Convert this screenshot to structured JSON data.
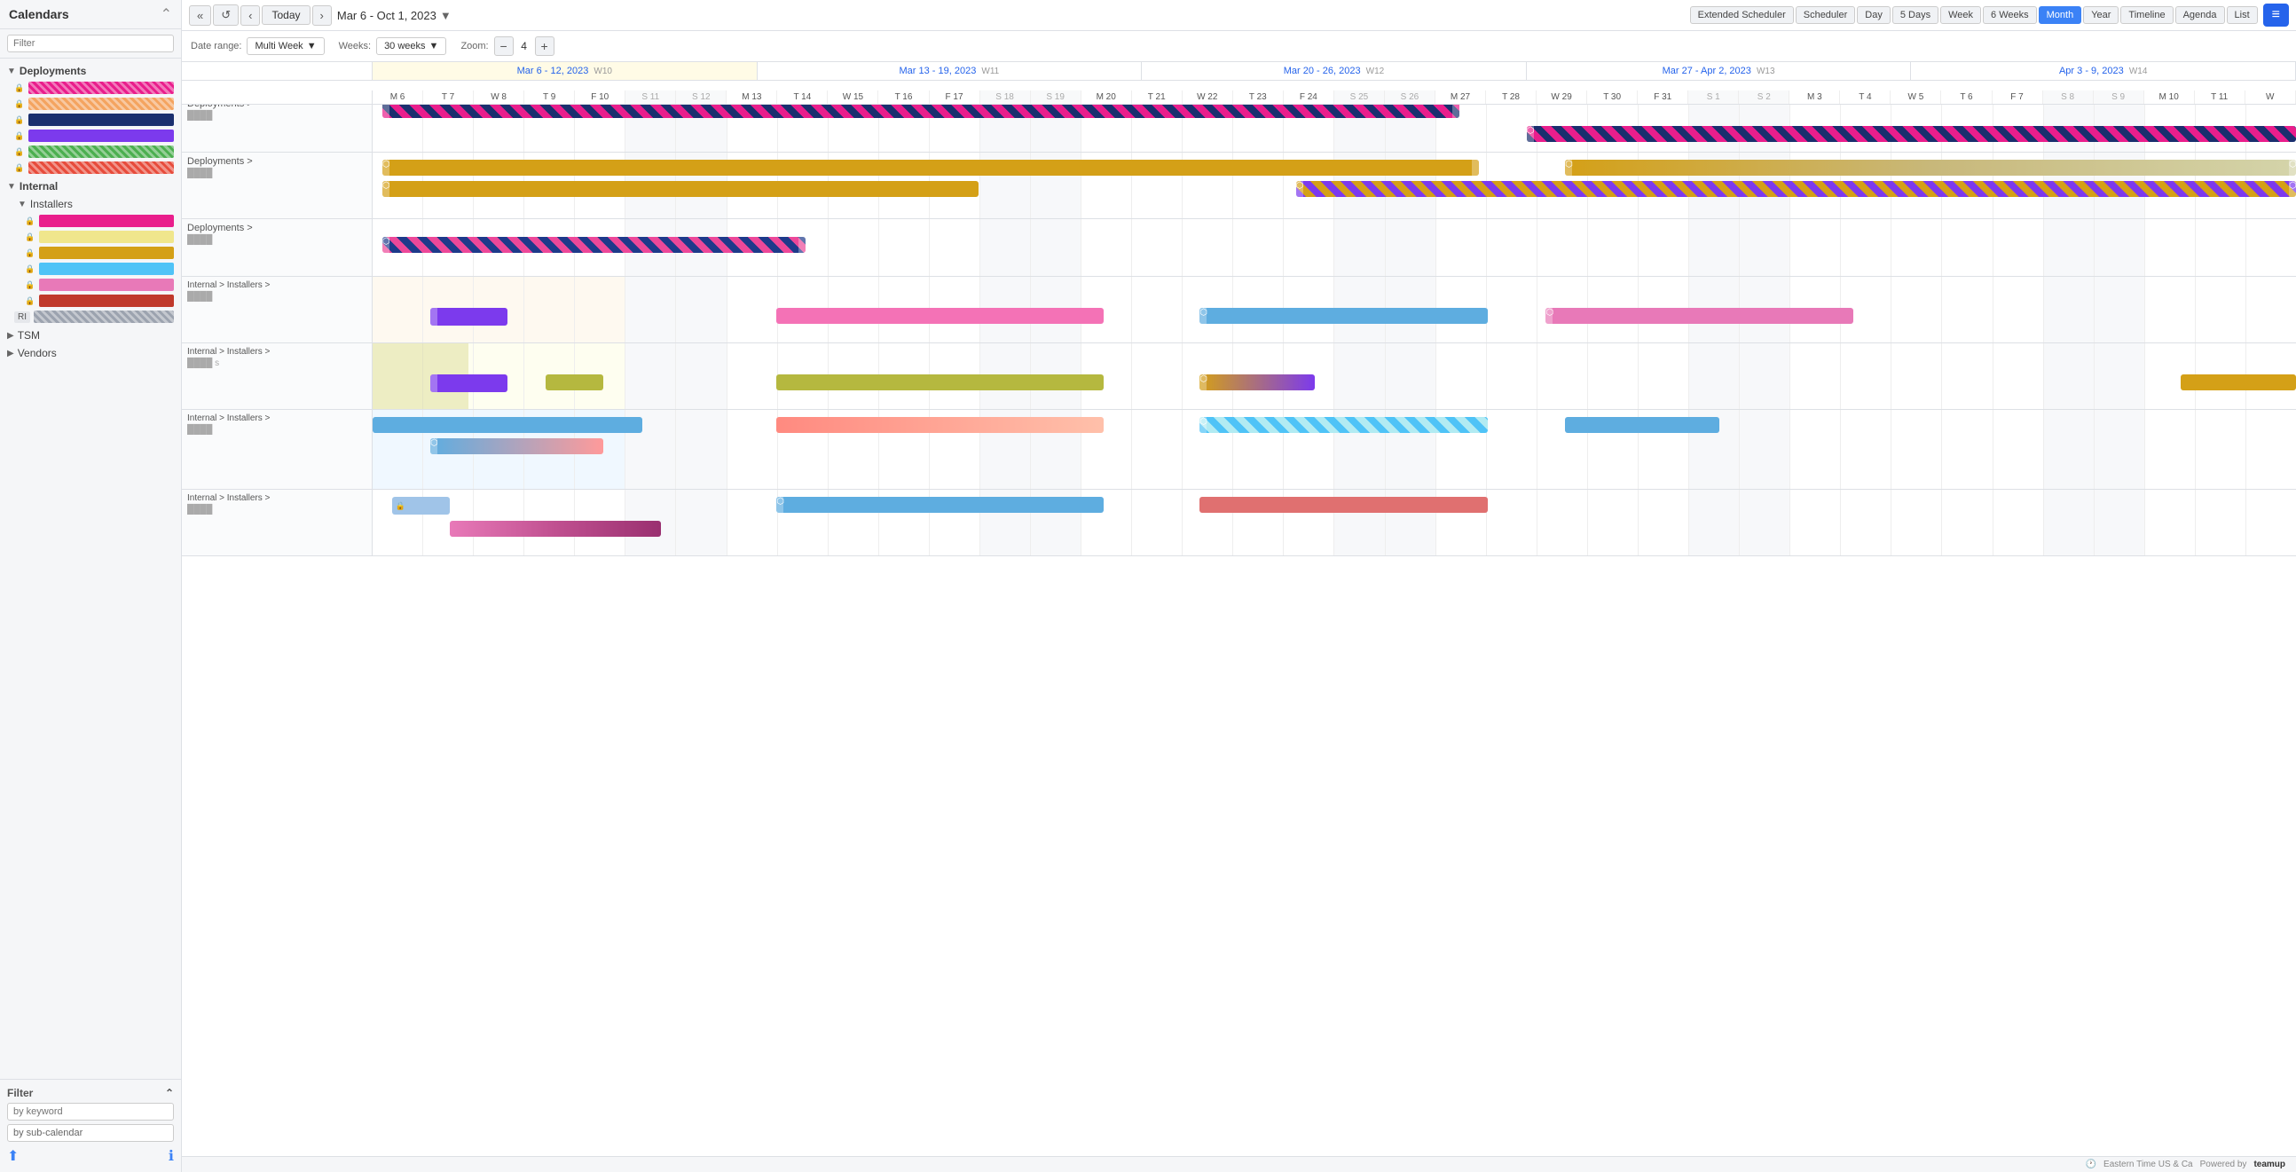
{
  "app": {
    "title": "Calendars"
  },
  "toolbar": {
    "today_label": "Today",
    "date_range": "Mar 6 - Oct 1, 2023",
    "views": [
      "Extended Scheduler",
      "Scheduler",
      "Day",
      "5 Days",
      "Week",
      "6 Weeks",
      "Month",
      "Year",
      "Timeline",
      "Agenda",
      "List"
    ],
    "active_view": "Month"
  },
  "controls": {
    "date_range_label": "Date range:",
    "date_range_value": "Multi Week",
    "weeks_label": "Weeks:",
    "weeks_value": "30 weeks",
    "zoom_label": "Zoom:",
    "zoom_value": "4"
  },
  "sidebar": {
    "title": "Calendars",
    "filter_placeholder": "Filter",
    "groups": [
      {
        "name": "Deployments",
        "expanded": true,
        "items": [
          {
            "color": "#e91e8c",
            "striped": true
          },
          {
            "color": "#f4a460",
            "striped": false
          },
          {
            "color": "#1a2f6e",
            "striped": false
          },
          {
            "color": "#7c3aed",
            "striped": false
          },
          {
            "color": "#4caf50",
            "striped": true
          },
          {
            "color": "#e74c3c",
            "striped": true
          }
        ]
      },
      {
        "name": "Internal",
        "expanded": true,
        "subgroups": [
          {
            "name": "Installers",
            "expanded": true,
            "items": [
              {
                "color": "#e91e8c",
                "striped": false
              },
              {
                "color": "#f0e68c",
                "striped": false
              },
              {
                "color": "#d4a017",
                "striped": false
              },
              {
                "color": "#4fc3f7",
                "striped": false
              },
              {
                "color": "#e879b8",
                "striped": false
              },
              {
                "color": "#c0392b",
                "striped": false
              }
            ]
          }
        ],
        "extra": "RI"
      }
    ],
    "tsm": "TSM",
    "vendors": "Vendors",
    "filter_label": "Filter",
    "filter_keyword_placeholder": "by keyword",
    "filter_subcal_placeholder": "by sub-calendar"
  },
  "week_headers": [
    {
      "label": "Mar 6 - 12, 2023",
      "week": "W10",
      "current": true
    },
    {
      "label": "Mar 13 - 19, 2023",
      "week": "W11",
      "current": false
    },
    {
      "label": "Mar 20 - 26, 2023",
      "week": "W12",
      "current": false
    },
    {
      "label": "Mar 27 - Apr 2, 2023",
      "week": "W13",
      "current": false
    },
    {
      "label": "Apr 3 - 9, 2023",
      "week": "W14",
      "current": false
    }
  ],
  "day_headers": [
    "M 6",
    "T 7",
    "W 8",
    "T 9",
    "F 10",
    "S 11",
    "S 12",
    "M 13",
    "T 14",
    "W 15",
    "T 16",
    "F 17",
    "S 18",
    "S 19",
    "M 20",
    "T 21",
    "W 22",
    "T 23",
    "F 24",
    "S 25",
    "S 26",
    "M 27",
    "T 28",
    "W 29",
    "T 30",
    "F 31",
    "S 1",
    "S 2",
    "M 3",
    "T 4",
    "W 5",
    "T 6",
    "F 7",
    "S 8",
    "S 9",
    "M 10",
    "T 11",
    "W"
  ],
  "rows": [
    {
      "label": "Deployments >",
      "sub_label": ""
    },
    {
      "label": "Deployments >",
      "sub_label": ""
    },
    {
      "label": "Deployments >",
      "sub_label": ""
    },
    {
      "label": "Internal > Installers >",
      "sub_label": ""
    },
    {
      "label": "Internal > Installers >",
      "sub_label": ""
    },
    {
      "label": "Internal > Installers >",
      "sub_label": ""
    },
    {
      "label": "Internal > Installers >",
      "sub_label": ""
    }
  ],
  "status": {
    "timezone": "Eastern Time US & Ca",
    "powered_by": "Powered by",
    "brand": "teamup"
  }
}
